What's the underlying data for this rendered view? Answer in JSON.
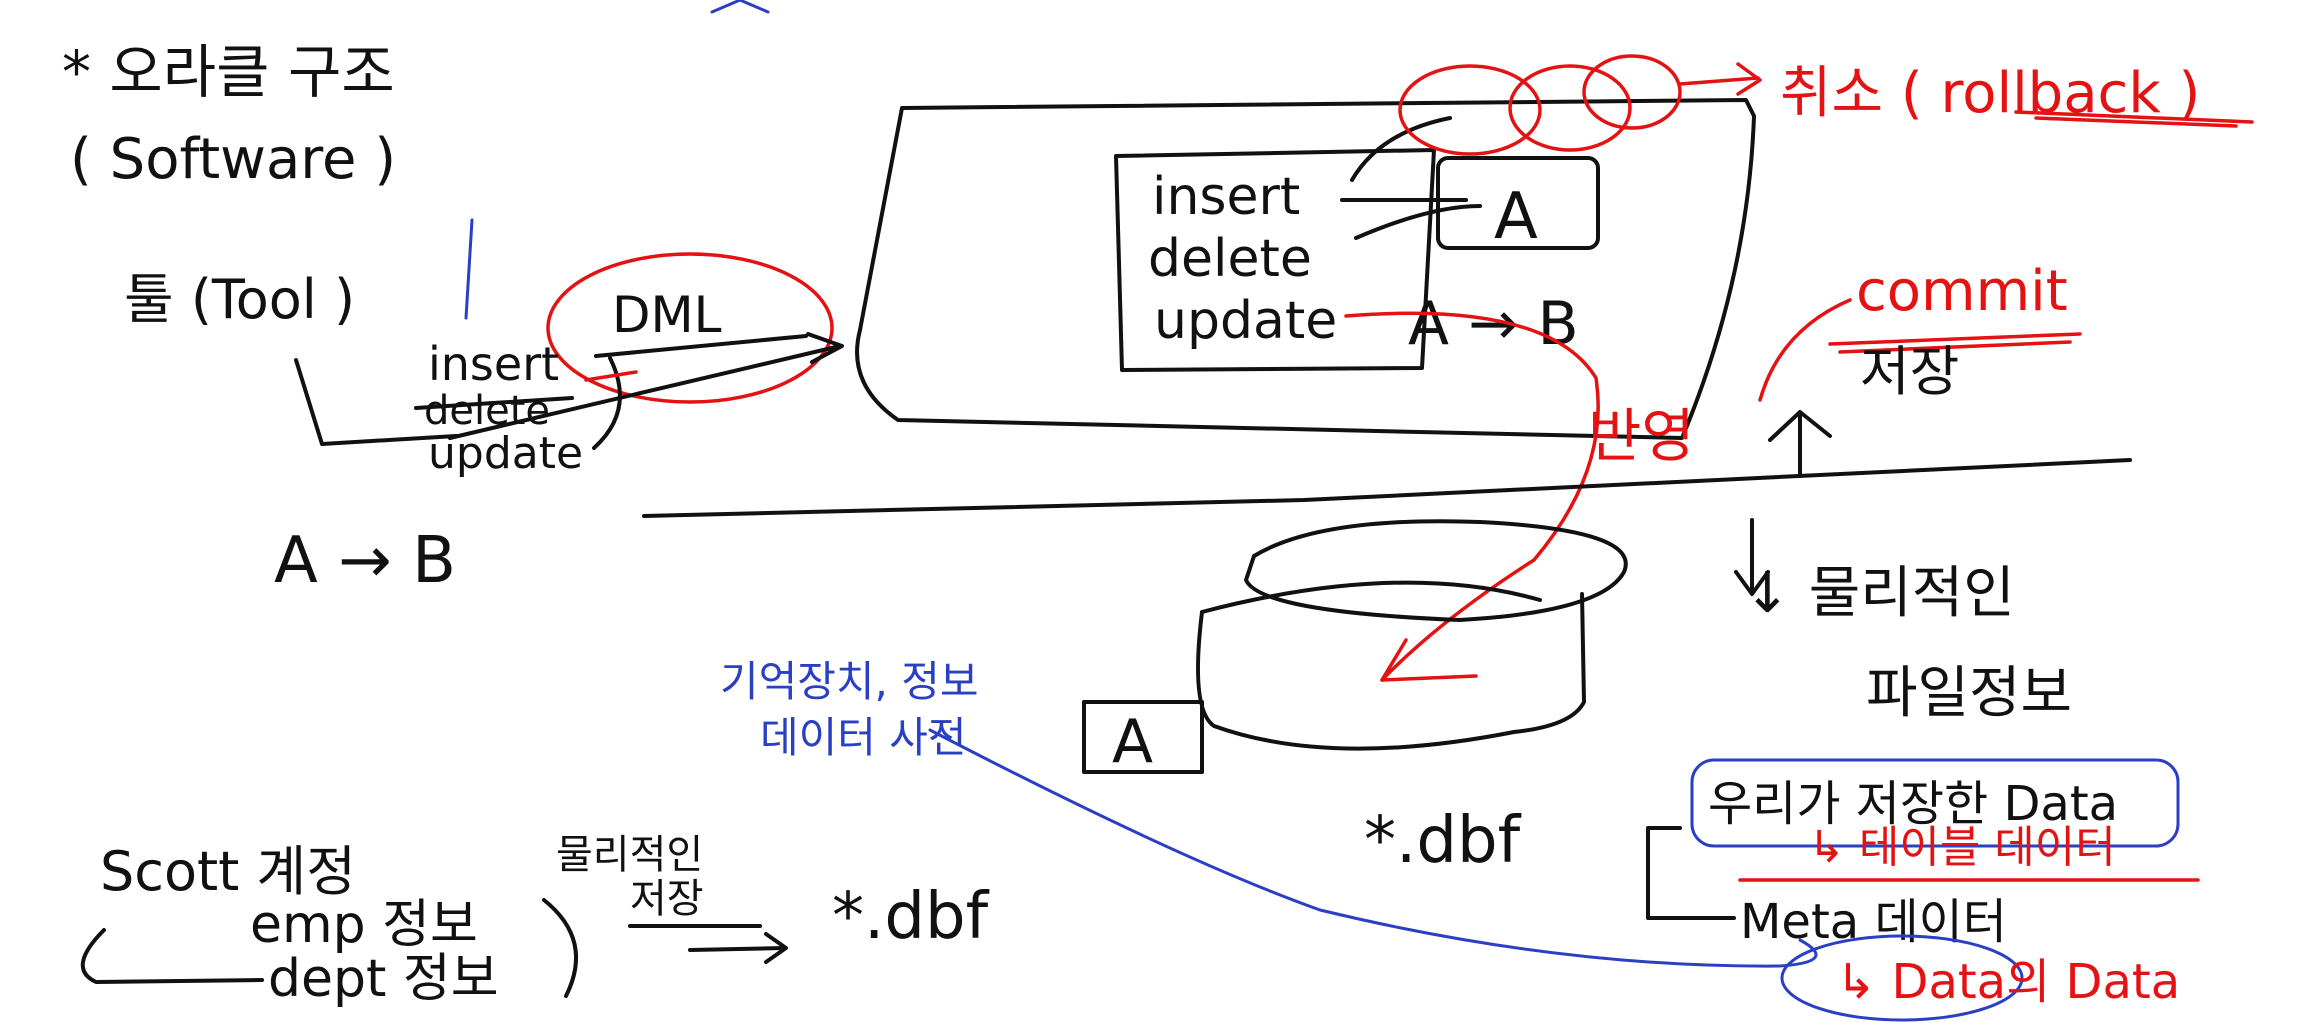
{
  "colors": {
    "ink": "#111111",
    "red": "#e41212",
    "blue": "#2a3fc4",
    "background": "#ffffff"
  },
  "left": {
    "title": "* 오라클 구조",
    "subtitle": "( Software )",
    "tool": "툴 (Tool )",
    "dml": "DML",
    "cmd_insert": "insert",
    "cmd_delete": "delete",
    "cmd_update": "update",
    "a_to_b": "A → B"
  },
  "memory": {
    "cmd_insert": "insert",
    "cmd_delete": "delete",
    "cmd_update": "update",
    "box_a": "A",
    "a_to_b": "A → B"
  },
  "right": {
    "cancel": "취소 ( rollback )",
    "commit": "commit",
    "confirm": "저장",
    "reflect": "반영",
    "physical_1": "↓ 물리적인",
    "physical_2": "파일정보",
    "user_data": "우리가 저장한 Data",
    "table_data": "↳ 테이블 데이터",
    "meta": "Meta 데이터",
    "data_data": "↳ Data의 Data",
    "dbf": "*.dbf"
  },
  "disk": {
    "box_a": "A"
  },
  "blue_note": {
    "line1": "기억장치, 정보",
    "line2": "데이터 사전"
  },
  "bottom": {
    "scott": "Scott 계정",
    "emp": "emp 정보",
    "dept": "dept 정보",
    "physical": "물리적인",
    "store": "저장",
    "dbf": "*.dbf"
  }
}
